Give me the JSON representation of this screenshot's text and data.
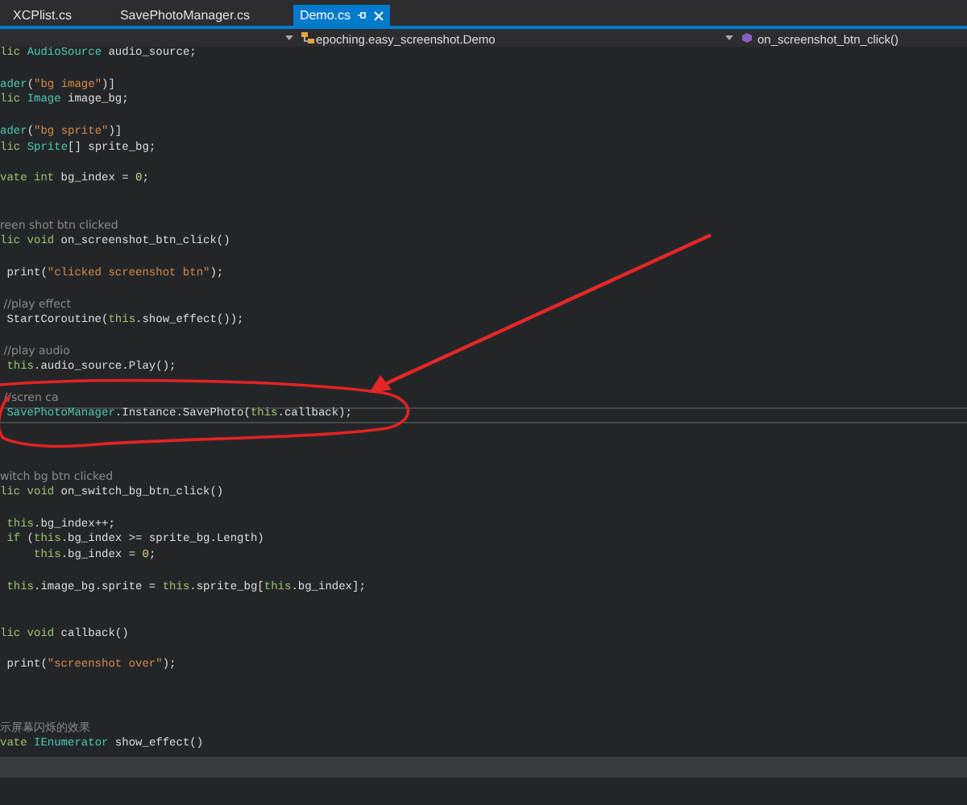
{
  "tabs": [
    {
      "label": "XCPlist.cs",
      "selected": false
    },
    {
      "label": "SavePhotoManager.cs",
      "selected": false
    },
    {
      "label": "Demo.cs",
      "selected": true
    }
  ],
  "navigation_bar": {
    "class_dropdown": "epoching.easy_screenshot.Demo",
    "member_dropdown": "on_screenshot_btn_click()"
  },
  "code_lines": [
    {
      "kind": "code",
      "current": false,
      "tokens": [
        {
          "kind": "kw",
          "t": "lic "
        },
        {
          "kind": "type",
          "t": "AudioSource"
        },
        {
          "kind": "plain",
          "t": " audio_source;"
        }
      ]
    },
    {
      "kind": "blank",
      "current": false
    },
    {
      "kind": "code",
      "current": false,
      "tokens": [
        {
          "kind": "type",
          "t": "ader"
        },
        {
          "kind": "plain",
          "t": "("
        },
        {
          "kind": "str",
          "t": "\"bg image\""
        },
        {
          "kind": "plain",
          "t": ")]"
        }
      ]
    },
    {
      "kind": "code",
      "current": false,
      "tokens": [
        {
          "kind": "kw",
          "t": "lic "
        },
        {
          "kind": "type",
          "t": "Image"
        },
        {
          "kind": "plain",
          "t": " image_bg;"
        }
      ]
    },
    {
      "kind": "blank",
      "current": false
    },
    {
      "kind": "code",
      "current": false,
      "tokens": [
        {
          "kind": "type",
          "t": "ader"
        },
        {
          "kind": "plain",
          "t": "("
        },
        {
          "kind": "str",
          "t": "\"bg sprite\""
        },
        {
          "kind": "plain",
          "t": ")]"
        }
      ]
    },
    {
      "kind": "code",
      "current": false,
      "tokens": [
        {
          "kind": "kw",
          "t": "lic "
        },
        {
          "kind": "type",
          "t": "Sprite"
        },
        {
          "kind": "plain",
          "t": "[] sprite_bg;"
        }
      ]
    },
    {
      "kind": "blank",
      "current": false
    },
    {
      "kind": "code",
      "current": false,
      "tokens": [
        {
          "kind": "kw",
          "t": "vate int"
        },
        {
          "kind": "plain",
          "t": " bg_index = "
        },
        {
          "kind": "num",
          "t": "0"
        },
        {
          "kind": "plain",
          "t": ";"
        }
      ]
    },
    {
      "kind": "blank",
      "current": false
    },
    {
      "kind": "blank",
      "current": false
    },
    {
      "kind": "code",
      "current": false,
      "tokens": [
        {
          "kind": "com",
          "t": "reen shot btn clicked"
        }
      ]
    },
    {
      "kind": "code",
      "current": false,
      "tokens": [
        {
          "kind": "kw",
          "t": "lic void"
        },
        {
          "kind": "plain",
          "t": " on_screenshot_btn_click()"
        }
      ]
    },
    {
      "kind": "blank",
      "current": false
    },
    {
      "kind": "code",
      "current": false,
      "tokens": [
        {
          "kind": "plain",
          "t": " print("
        },
        {
          "kind": "str",
          "t": "\"clicked screenshot btn\""
        },
        {
          "kind": "plain",
          "t": ");"
        }
      ]
    },
    {
      "kind": "blank",
      "current": false
    },
    {
      "kind": "code",
      "current": false,
      "tokens": [
        {
          "kind": "com",
          "t": " //play effect"
        }
      ]
    },
    {
      "kind": "code",
      "current": false,
      "tokens": [
        {
          "kind": "plain",
          "t": " StartCoroutine("
        },
        {
          "kind": "kw",
          "t": "this"
        },
        {
          "kind": "plain",
          "t": ".show_effect());"
        }
      ]
    },
    {
      "kind": "blank",
      "current": false
    },
    {
      "kind": "code",
      "current": false,
      "tokens": [
        {
          "kind": "com",
          "t": " //play audio"
        }
      ]
    },
    {
      "kind": "code",
      "current": false,
      "tokens": [
        {
          "kind": "kw",
          "t": " this"
        },
        {
          "kind": "plain",
          "t": ".audio_source.Play();"
        }
      ]
    },
    {
      "kind": "blank",
      "current": false
    },
    {
      "kind": "code",
      "current": false,
      "tokens": [
        {
          "kind": "com",
          "t": " //scren ca"
        }
      ]
    },
    {
      "kind": "code",
      "current": true,
      "tokens": [
        {
          "kind": "type",
          "t": " SavePhotoManager"
        },
        {
          "kind": "plain",
          "t": ".Instance.SavePhoto("
        },
        {
          "kind": "kw",
          "t": "this"
        },
        {
          "kind": "plain",
          "t": ".callback);"
        }
      ]
    },
    {
      "kind": "blank",
      "current": false
    },
    {
      "kind": "blank",
      "current": false
    },
    {
      "kind": "blank",
      "current": false
    },
    {
      "kind": "code",
      "current": false,
      "tokens": [
        {
          "kind": "com",
          "t": "witch bg btn clicked"
        }
      ]
    },
    {
      "kind": "code",
      "current": false,
      "tokens": [
        {
          "kind": "kw",
          "t": "lic void"
        },
        {
          "kind": "plain",
          "t": " on_switch_bg_btn_click()"
        }
      ]
    },
    {
      "kind": "blank",
      "current": false
    },
    {
      "kind": "code",
      "current": false,
      "tokens": [
        {
          "kind": "kw",
          "t": " this"
        },
        {
          "kind": "plain",
          "t": ".bg_index++;"
        }
      ]
    },
    {
      "kind": "code",
      "current": false,
      "tokens": [
        {
          "kind": "kw",
          "t": " if"
        },
        {
          "kind": "plain",
          "t": " ("
        },
        {
          "kind": "kw",
          "t": "this"
        },
        {
          "kind": "plain",
          "t": ".bg_index >= sprite_bg.Length)"
        }
      ]
    },
    {
      "kind": "code",
      "current": false,
      "tokens": [
        {
          "kind": "kw",
          "t": "     this"
        },
        {
          "kind": "plain",
          "t": ".bg_index = "
        },
        {
          "kind": "num",
          "t": "0"
        },
        {
          "kind": "plain",
          "t": ";"
        }
      ]
    },
    {
      "kind": "blank",
      "current": false
    },
    {
      "kind": "code",
      "current": false,
      "tokens": [
        {
          "kind": "kw",
          "t": " this"
        },
        {
          "kind": "plain",
          "t": ".image_bg.sprite = "
        },
        {
          "kind": "kw",
          "t": "this"
        },
        {
          "kind": "plain",
          "t": ".sprite_bg["
        },
        {
          "kind": "kw",
          "t": "this"
        },
        {
          "kind": "plain",
          "t": ".bg_index];"
        }
      ]
    },
    {
      "kind": "blank",
      "current": false
    },
    {
      "kind": "blank",
      "current": false
    },
    {
      "kind": "code",
      "current": false,
      "tokens": [
        {
          "kind": "kw",
          "t": "lic void"
        },
        {
          "kind": "plain",
          "t": " callback()"
        }
      ]
    },
    {
      "kind": "blank",
      "current": false
    },
    {
      "kind": "code",
      "current": false,
      "tokens": [
        {
          "kind": "plain",
          "t": " print("
        },
        {
          "kind": "str",
          "t": "\"screenshot over\""
        },
        {
          "kind": "plain",
          "t": ");"
        }
      ]
    },
    {
      "kind": "blank",
      "current": false
    },
    {
      "kind": "blank",
      "current": false
    },
    {
      "kind": "blank",
      "current": false
    },
    {
      "kind": "code",
      "current": false,
      "tokens": [
        {
          "kind": "com",
          "t": "示屏幕闪烁的效果"
        }
      ]
    },
    {
      "kind": "code",
      "current": false,
      "tokens": [
        {
          "kind": "kw",
          "t": "vate "
        },
        {
          "kind": "type",
          "t": "IEnumerator"
        },
        {
          "kind": "plain",
          "t": " show_effect()"
        }
      ]
    }
  ]
}
